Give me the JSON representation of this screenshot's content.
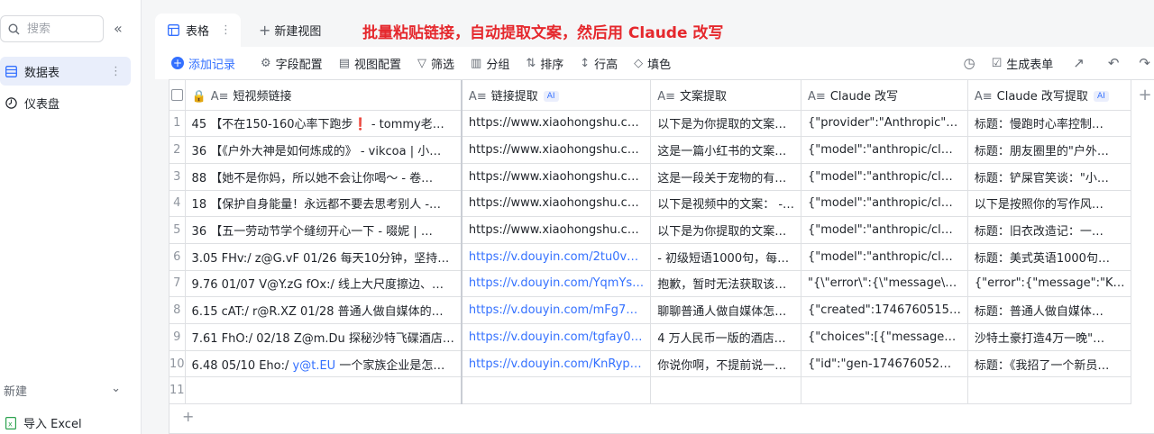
{
  "sidebar": {
    "search_placeholder": "搜索",
    "items": [
      {
        "label": "数据表"
      },
      {
        "label": "仪表盘"
      }
    ],
    "new_label": "新建",
    "import_label": "导入 Excel"
  },
  "tabs": {
    "active_label": "表格",
    "new_view_label": "新建视图"
  },
  "banner": "批量粘贴链接，自动提取文案，然后用 Claude 改写",
  "toolbar": {
    "add_record": "添加记录",
    "field_config": "字段配置",
    "view_config": "视图配置",
    "filter": "筛选",
    "group": "分组",
    "sort": "排序",
    "row_height": "行高",
    "fill": "填色",
    "generate_form": "生成表单"
  },
  "table": {
    "columns": [
      {
        "label": "短视频链接",
        "ai": ""
      },
      {
        "label": "链接提取",
        "ai": "AI"
      },
      {
        "label": "文案提取",
        "ai": ""
      },
      {
        "label": "Claude 改写",
        "ai": ""
      },
      {
        "label": "Claude 改写提取",
        "ai": "AI"
      }
    ],
    "rows": [
      {
        "n": "1",
        "c1": "45 【不在150-160心率下跑步❗️ - tommy老…",
        "c2": "https://www.xiaohongshu.c…",
        "c3": "以下是为你提取的文案…",
        "c4": "{\"provider\":\"Anthropic\"…",
        "c5": "标题：慢跑时心率控制…"
      },
      {
        "n": "2",
        "c1": "36 【《户外大神是如何炼成的》 - vikcoa | 小…",
        "c2": "https://www.xiaohongshu.c…",
        "c3": "这是一篇小红书的文案…",
        "c4": "{\"model\":\"anthropic/cl…",
        "c5": "标题：朋友圈里的\"户外…"
      },
      {
        "n": "3",
        "c1": "88 【她不是你妈，所以她不会让你喝～ - 卷…",
        "c2": "https://www.xiaohongshu.c…",
        "c3": "这是一段关于宠物的有…",
        "c4": "{\"model\":\"anthropic/cl…",
        "c5": "标题：铲屎官笑谈：\"小…"
      },
      {
        "n": "4",
        "c1": "18 【保护自身能量！永远都不要去思考别人 -…",
        "c2": "https://www.xiaohongshu.c…",
        "c3": "以下是视频中的文案： -…",
        "c4": "{\"model\":\"anthropic/cl…",
        "c5": "以下是按照你的写作风…"
      },
      {
        "n": "5",
        "c1": "36 【五一劳动节学个缝纫开心一下 - 啜妮 | …",
        "c2": "https://www.xiaohongshu.c…",
        "c3": "以下是为你提取的文案…",
        "c4": "{\"model\":\"anthropic/cl…",
        "c5": "标题：旧衣改造记：一…"
      },
      {
        "n": "6",
        "c1": "3.05 FHv:/ z@G.vF 01/26 每天10分钟，坚持…",
        "c2": "https://v.douyin.com/2tu0v…",
        "c3": "- 初级短语1000句，每…",
        "c4": "{\"model\":\"anthropic/cl…",
        "c5": "标题：美式英语1000句…"
      },
      {
        "n": "7",
        "c1": "9.76 01/07 V@Y.zG fOx:/ 线上大尺度擦边、…",
        "c2": "https://v.douyin.com/YqmYs…",
        "c3": "抱歉，暂时无法获取该…",
        "c4": "\"{\\\"error\\\":{\\\"message\\…",
        "c5": "{\"error\":{\"message\":\"K…"
      },
      {
        "n": "8",
        "c1": "6.15 cAT:/ r@R.XZ 01/28 普通人做自媒体的…",
        "c2": "https://v.douyin.com/mFg7…",
        "c3": "聊聊普通人做自媒体怎…",
        "c4": "{\"created\":1746760515…",
        "c5": "标题：普通人做自媒体…"
      },
      {
        "n": "9",
        "c1": "7.61 FhO:/ 02/18 Z@m.Du 探秘沙特飞碟酒店…",
        "c2": "https://v.douyin.com/tgfay0…",
        "c3": "4 万人民币一版的酒店…",
        "c4": "{\"choices\":[{\"message…",
        "c5": "沙特土豪打造4万一晚\"…"
      },
      {
        "n": "10",
        "c1a": "6.48 05/10 Eho:/ ",
        "c1b": "y@t.EU",
        "c1c": " 一个家族企业是怎…",
        "c2": "https://v.douyin.com/KnRyp…",
        "c3": "你说你啊，不提前说一…",
        "c4": "{\"id\":\"gen-174676052…",
        "c5": "标题：《我招了一个新员…"
      },
      {
        "n": "11",
        "c1": "",
        "c2": "",
        "c3": "",
        "c4": "",
        "c5": ""
      }
    ]
  },
  "colors": {
    "accent": "#3370ff",
    "banner": "#e5282d",
    "active_sidebar": "#e9eefb"
  },
  "icons": [
    "search-icon",
    "collapse-icon",
    "table-icon",
    "dashboard-icon",
    "excel-icon",
    "chevron-down-icon",
    "plus-icon",
    "more-icon",
    "settings-icon",
    "filter-icon",
    "group-icon",
    "sort-icon",
    "row-height-icon",
    "fill-icon",
    "history-icon",
    "form-icon",
    "share-icon",
    "undo-icon",
    "redo-icon",
    "lock-icon",
    "text-field-icon"
  ]
}
